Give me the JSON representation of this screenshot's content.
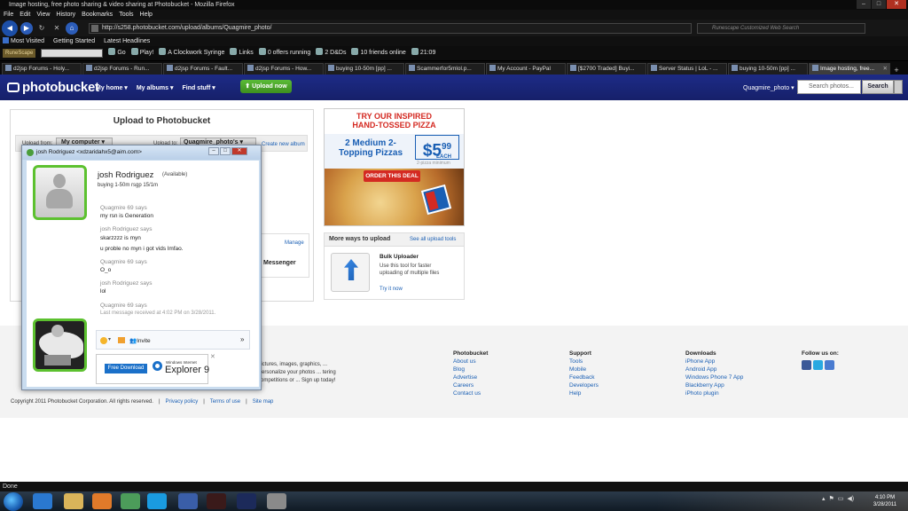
{
  "window": {
    "title": "Image hosting, free photo sharing & video sharing at Photobucket - Mozilla Firefox"
  },
  "menu": [
    "File",
    "Edit",
    "View",
    "History",
    "Bookmarks",
    "Tools",
    "Help"
  ],
  "nav": {
    "url": "http://s258.photobucket.com/upload/albums/Quagmire_photo/",
    "search_placeholder": "Runescape Customized Web Search"
  },
  "bookmarks": [
    "Most Visited",
    "Getting Started",
    "Latest Headlines"
  ],
  "toolbar": {
    "logo": "RuneScape",
    "go": "Go",
    "play": "Play!",
    "syringe": "A Clockwork Syringe",
    "links": "Links",
    "offers": "0 offers running",
    "dnd": "2 D&Ds",
    "friends": "10 friends online",
    "time": "21:09"
  },
  "tabs": [
    {
      "label": "d2jsp Forums - Holy..."
    },
    {
      "label": "d2jsp Forums - Run..."
    },
    {
      "label": "d2jsp Forums - Fault..."
    },
    {
      "label": "d2jsp Forums - How..."
    },
    {
      "label": "buying 10-50m [pp] ..."
    },
    {
      "label": "Scammerfor5mlol.p..."
    },
    {
      "label": "My Account - PayPal"
    },
    {
      "label": "[$2700 Traded] Buyi..."
    },
    {
      "label": "Server Status | LoL - ..."
    },
    {
      "label": "buying 10-50m [pp] ..."
    },
    {
      "label": "Image hosting, free..."
    }
  ],
  "pb": {
    "logo": "photobucket",
    "nav": [
      "My home",
      "My albums",
      "Find stuff"
    ],
    "upload_now": "Upload now",
    "user": "Quagmire_photo",
    "search_placeholder": "Search photos...",
    "search_btn": "Search",
    "upload_title": "Upload to Photobucket",
    "upload_from": "Upload from:",
    "my_computer": "My computer",
    "upload_to": "Upload to:",
    "album": "Quagmire_photo's",
    "create_album": "Create new album",
    "manage": "Manage",
    "messenger": "Messenger"
  },
  "ad": {
    "headline1": "TRY OUR INSPIRED",
    "headline2": "HAND-TOSSED PIZZA",
    "offer": "2 Medium 2-Topping Pizzas",
    "price": "$5",
    "price_cents": "99",
    "each": "EACH",
    "min": "2-pizza minimum",
    "cta": "ORDER THIS DEAL",
    "brand": "Domino's Pizza"
  },
  "moreways": {
    "title": "More ways to upload",
    "see_all": "See all upload tools",
    "bulk_title": "Bulk Uploader",
    "bulk_desc": "Use this tool for faster uploading of multiple files",
    "try_now": "Try it now"
  },
  "footer": {
    "intro": "pictures, images, graphics, ... Personalize your photos ... tering competitions or ... Sign up today!",
    "cols": [
      {
        "h": "Photobucket",
        "items": [
          "About us",
          "Blog",
          "Advertise",
          "Careers",
          "Contact us"
        ]
      },
      {
        "h": "Support",
        "items": [
          "Tools",
          "Mobile",
          "Feedback",
          "Developers",
          "Help"
        ]
      },
      {
        "h": "Downloads",
        "items": [
          "iPhone App",
          "Android App",
          "Windows Phone 7 App",
          "Blackberry App",
          "iPhoto plugin"
        ]
      },
      {
        "h": "Follow us on:",
        "items": []
      }
    ],
    "copyright": "Copyright 2011 Photobucket Corporation.  All rights reserved.",
    "links": [
      "Privacy policy",
      "Terms of use",
      "Site map"
    ]
  },
  "msn": {
    "title": "josh Rodriguez <xdzaridahx5@aim.com>",
    "name": "josh Rodriguez",
    "status": "(Available)",
    "personal_msg": "buying 1-50m rsgp 15/1m",
    "messages": [
      {
        "who": "Quagmire 69 says",
        "lines": [
          "my rsn is Generation"
        ]
      },
      {
        "who": "josh Rodriguez says",
        "lines": [
          "skarzzzz is myn",
          "u proble no myn i got vids lmfao."
        ]
      },
      {
        "who": "Quagmire 69 says",
        "lines": [
          "O_o"
        ]
      },
      {
        "who": "josh Rodriguez says",
        "lines": [
          "lol"
        ]
      },
      {
        "who": "Quagmire 69 says",
        "lines": []
      }
    ],
    "last_msg": "Last message received at 4:02 PM on 3/28/2011.",
    "invite": "Invite",
    "ad_free": "Free Download",
    "ad_ie_small": "Windows Internet",
    "ad_ie": "Explorer 9"
  },
  "status": "Done",
  "clock": {
    "time": "4:10 PM",
    "date": "3/28/2011"
  }
}
